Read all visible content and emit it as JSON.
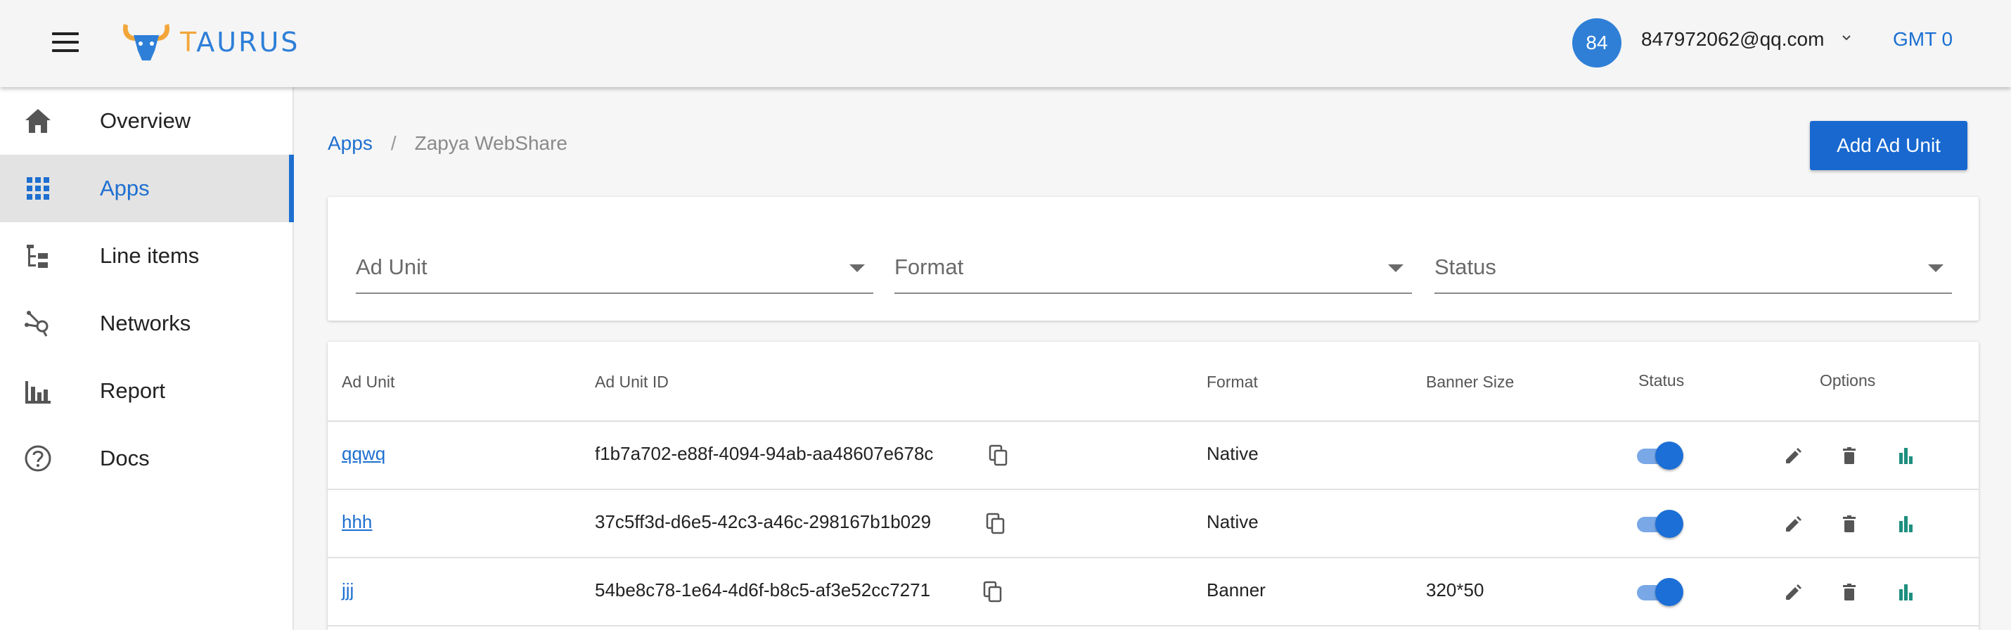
{
  "header": {
    "logo_letter_first": "T",
    "logo_letter_rest": "AURUS",
    "avatar_text": "84",
    "user_email": "847972062@qq.com",
    "timezone": "GMT 0"
  },
  "sidebar": {
    "items": [
      {
        "label": "Overview",
        "icon": "home-icon"
      },
      {
        "label": "Apps",
        "icon": "apps-grid-icon",
        "active": true
      },
      {
        "label": "Line items",
        "icon": "line-items-icon"
      },
      {
        "label": "Networks",
        "icon": "networks-icon"
      },
      {
        "label": "Report",
        "icon": "report-icon"
      },
      {
        "label": "Docs",
        "icon": "help-icon"
      }
    ]
  },
  "breadcrumb": {
    "parent": "Apps",
    "separator": "/",
    "current": "Zapya WebShare"
  },
  "actions": {
    "add_ad_unit": "Add Ad Unit"
  },
  "filters": [
    {
      "label": "Ad Unit"
    },
    {
      "label": "Format"
    },
    {
      "label": "Status"
    }
  ],
  "table": {
    "headers": [
      "Ad Unit",
      "Ad Unit ID",
      "Format",
      "Banner Size",
      "Status",
      "Options"
    ],
    "rows": [
      {
        "name": "qqwq",
        "id": "f1b7a702-e88f-4094-94ab-aa48607e678c",
        "format": "Native",
        "banner_size": "",
        "status_on": true
      },
      {
        "name": "hhh",
        "id": "37c5ff3d-d6e5-42c3-a46c-298167b1b029",
        "format": "Native",
        "banner_size": "",
        "status_on": true
      },
      {
        "name": "jjj",
        "id": "54be8c78-1e64-4d6f-b8c5-af3e52cc7271",
        "format": "Banner",
        "banner_size": "320*50",
        "status_on": true
      }
    ]
  },
  "colors": {
    "primary": "#1d6fd0",
    "logo_orange": "#f2a63a",
    "report_green": "#1f8f7f"
  }
}
